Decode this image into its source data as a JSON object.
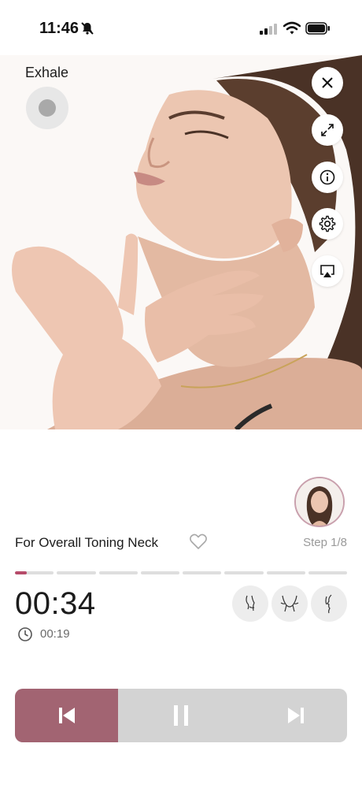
{
  "status_bar": {
    "time": "11:46"
  },
  "video": {
    "breath_label": "Exhale"
  },
  "controls": {
    "close": "close-icon",
    "fullscreen": "expand-icon",
    "info": "info-icon",
    "settings": "gear-icon",
    "airplay": "airplay-icon"
  },
  "exercise": {
    "title": "For Overall Toning Neck",
    "step": "Step 1/8",
    "progress_segments": 8,
    "current_segment_fill": 0.3
  },
  "timer": {
    "main": "00:34",
    "sub": "00:19"
  },
  "views": [
    "side-view-icon",
    "front-view-icon",
    "profile-view-icon"
  ],
  "player": {
    "progress_fraction": 0.31,
    "accent": "#a26472",
    "track": "#d3d3d3"
  },
  "colors": {
    "accent": "#b64b6a",
    "avatar_ring": "#c9a0ad"
  }
}
